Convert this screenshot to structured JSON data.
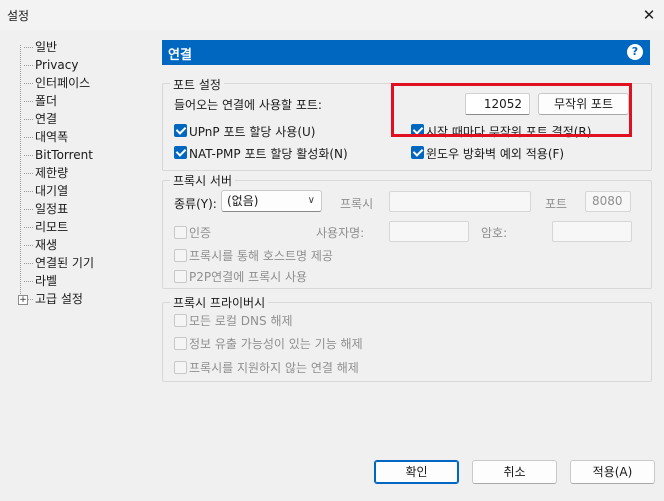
{
  "window": {
    "title": "설정",
    "close_glyph": "✕"
  },
  "sidebar": {
    "items": [
      {
        "label": "일반"
      },
      {
        "label": "Privacy"
      },
      {
        "label": "인터페이스"
      },
      {
        "label": "폴더"
      },
      {
        "label": "연결"
      },
      {
        "label": "대역폭"
      },
      {
        "label": "BitTorrent"
      },
      {
        "label": "제한량"
      },
      {
        "label": "대기열"
      },
      {
        "label": "일정표"
      },
      {
        "label": "리모트"
      },
      {
        "label": "재생"
      },
      {
        "label": "연결된 기기"
      },
      {
        "label": "라벨"
      },
      {
        "label": "고급 설정"
      }
    ],
    "expander_glyph": "+"
  },
  "panel": {
    "title": "연결",
    "help_glyph": "?"
  },
  "port_settings": {
    "title": "포트 설정",
    "incoming_label": "들어오는 연결에 사용할 포트:",
    "port_value": "12052",
    "random_port_button": "무작위 포트",
    "upnp": {
      "label": "UPnP 포트 할당 사용(U)",
      "checked": true
    },
    "random_on_start": {
      "label": "시작 때마다 무작위 포트 결정(R)",
      "checked": true
    },
    "natpmp": {
      "label": "NAT-PMP 포트 할당 활성화(N)",
      "checked": true
    },
    "firewall": {
      "label": "윈도우 방화벽 예외 적용(F)",
      "checked": true
    }
  },
  "proxy_server": {
    "title": "프록시 서버",
    "type_label": "종류(Y):",
    "type_value": "(없음)",
    "proxy_label": "프록시",
    "proxy_value": "",
    "port_label": "포트",
    "port_value": "8080",
    "auth": {
      "label": "인증",
      "checked": false
    },
    "username_label": "사용자명:",
    "password_label": "암호:",
    "hostname_lookup": {
      "label": "프록시를 통해 호스트명 제공",
      "checked": false
    },
    "p2p_proxy": {
      "label": "P2P연결에 프록시 사용",
      "checked": false
    }
  },
  "proxy_privacy": {
    "title": "프록시 프라이버시",
    "disable_dns": {
      "label": "모든 로컬 DNS 해제",
      "checked": false
    },
    "disable_leak": {
      "label": "정보 유출 가능성이 있는 기능 해제",
      "checked": false
    },
    "disable_unsupported": {
      "label": "프록시를 지원하지 않는 연결 해제",
      "checked": false
    }
  },
  "footer": {
    "ok": "확인",
    "cancel": "취소",
    "apply": "적용(A)"
  },
  "colors": {
    "accent": "#0067c0",
    "highlight": "#e11020"
  }
}
